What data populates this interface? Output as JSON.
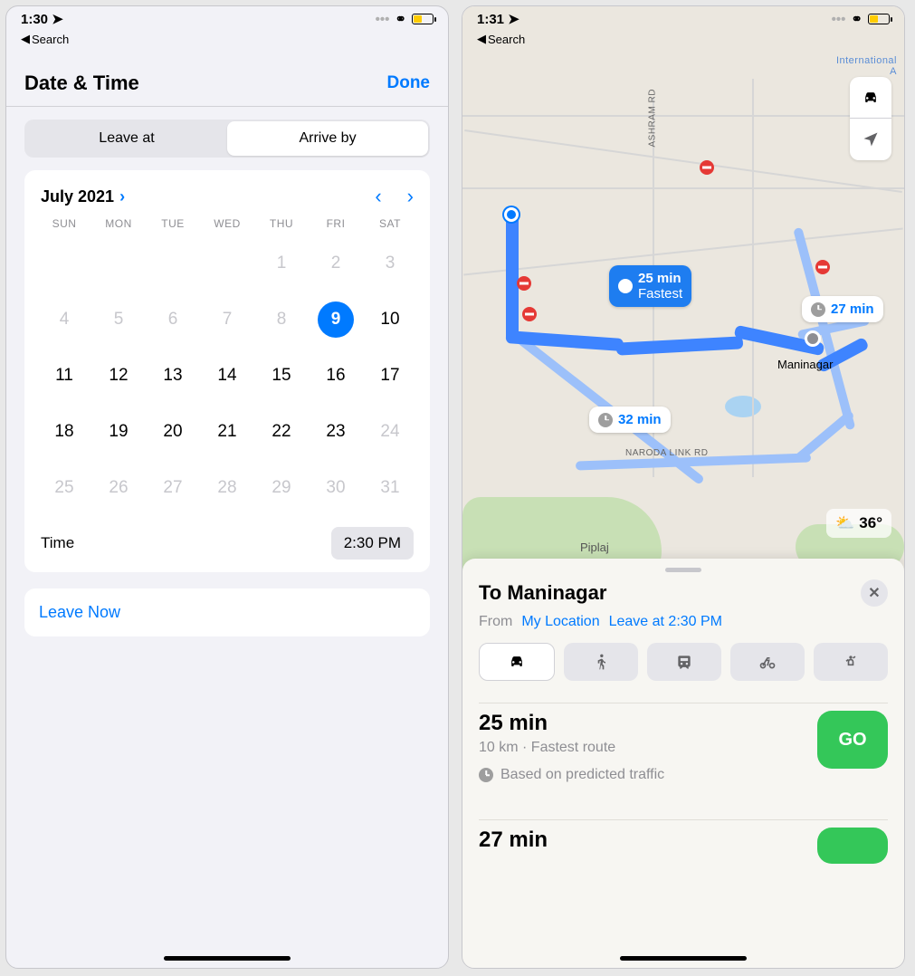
{
  "left": {
    "status_time": "1:30",
    "back_label": "Search",
    "sheet_title": "Date & Time",
    "done": "Done",
    "seg": {
      "leave": "Leave at",
      "arrive": "Arrive by",
      "selected": "arrive"
    },
    "month": "July 2021",
    "dow": [
      "SUN",
      "MON",
      "TUE",
      "WED",
      "THU",
      "FRI",
      "SAT"
    ],
    "weeks": [
      [
        {
          "n": ""
        },
        {
          "n": ""
        },
        {
          "n": ""
        },
        {
          "n": ""
        },
        {
          "n": "1",
          "dim": true
        },
        {
          "n": "2",
          "dim": true
        },
        {
          "n": "3",
          "dim": true
        }
      ],
      [
        {
          "n": "4",
          "dim": true
        },
        {
          "n": "5",
          "dim": true
        },
        {
          "n": "6",
          "dim": true
        },
        {
          "n": "7",
          "dim": true
        },
        {
          "n": "8",
          "dim": true
        },
        {
          "n": "9",
          "sel": true
        },
        {
          "n": "10"
        }
      ],
      [
        {
          "n": "11"
        },
        {
          "n": "12"
        },
        {
          "n": "13"
        },
        {
          "n": "14"
        },
        {
          "n": "15"
        },
        {
          "n": "16"
        },
        {
          "n": "17"
        }
      ],
      [
        {
          "n": "18"
        },
        {
          "n": "19"
        },
        {
          "n": "20"
        },
        {
          "n": "21"
        },
        {
          "n": "22"
        },
        {
          "n": "23"
        },
        {
          "n": "24",
          "dim": true
        }
      ],
      [
        {
          "n": "25",
          "dim": true
        },
        {
          "n": "26",
          "dim": true
        },
        {
          "n": "27",
          "dim": true
        },
        {
          "n": "28",
          "dim": true
        },
        {
          "n": "29",
          "dim": true
        },
        {
          "n": "30",
          "dim": true
        },
        {
          "n": "31",
          "dim": true
        }
      ]
    ],
    "time_label": "Time",
    "time_value": "2:30 PM",
    "leave_now": "Leave Now"
  },
  "right": {
    "status_time": "1:31",
    "back_label": "Search",
    "map_labels": {
      "airport": "International\nA",
      "road1": "ASHRAM RD",
      "road2": "NARODA LINK RD",
      "dest": "Maninagar",
      "town": "Piplaj"
    },
    "route_bubbles": {
      "fastest_time": "25 min",
      "fastest_sub": "Fastest",
      "alt1": "27 min",
      "alt2": "32 min"
    },
    "weather": "36°",
    "sheet": {
      "title": "To Maninagar",
      "from_label": "From",
      "from_value": "My Location",
      "leave_chip": "Leave at 2:30 PM",
      "routes": [
        {
          "time": "25 min",
          "sub": "10 km · Fastest route",
          "note": "Based on predicted traffic",
          "go": "GO"
        },
        {
          "time": "27 min"
        }
      ]
    }
  }
}
